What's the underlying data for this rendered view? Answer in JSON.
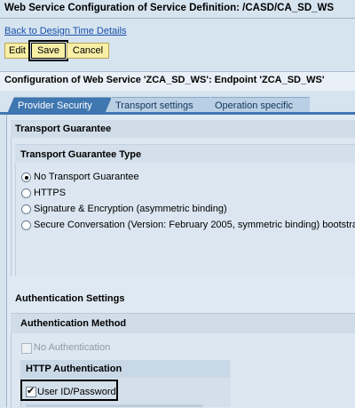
{
  "header": {
    "title": "Web Service Configuration of Service Definition: /CASD/CA_SD_WS",
    "back_link": "Back to Design Time Details",
    "buttons": {
      "edit": "Edit",
      "save": "Save",
      "cancel": "Cancel"
    }
  },
  "section": {
    "title": "Configuration of Web Service 'ZCA_SD_WS': Endpoint 'ZCA_SD_WS'"
  },
  "tabs": [
    {
      "label": "Provider Security",
      "active": true
    },
    {
      "label": "Transport settings",
      "active": false
    },
    {
      "label": "Operation specific",
      "active": false
    }
  ],
  "transport_guarantee": {
    "title": "Transport Guarantee",
    "type_title": "Transport Guarantee Type",
    "options": [
      {
        "label": "No Transport Guarantee",
        "selected": true
      },
      {
        "label": "HTTPS",
        "selected": false
      },
      {
        "label": "Signature & Encryption (asymmetric binding)",
        "selected": false
      },
      {
        "label": "Secure Conversation (Version: February 2005, symmetric binding) bootstra",
        "selected": false
      }
    ]
  },
  "authentication": {
    "settings_title": "Authentication Settings",
    "method_title": "Authentication Method",
    "no_auth_label": "No Authentication",
    "no_auth_checked": false,
    "http_title": "HTTP Authentication",
    "user_pw_label": "User ID/Password",
    "user_pw_checked": true
  },
  "colors": {
    "background": "#d6e4f0",
    "tab_active": "#3f77b1",
    "tab_inactive": "#b9cfe3",
    "button": "#f8efa7",
    "link": "#1a4fa8"
  }
}
